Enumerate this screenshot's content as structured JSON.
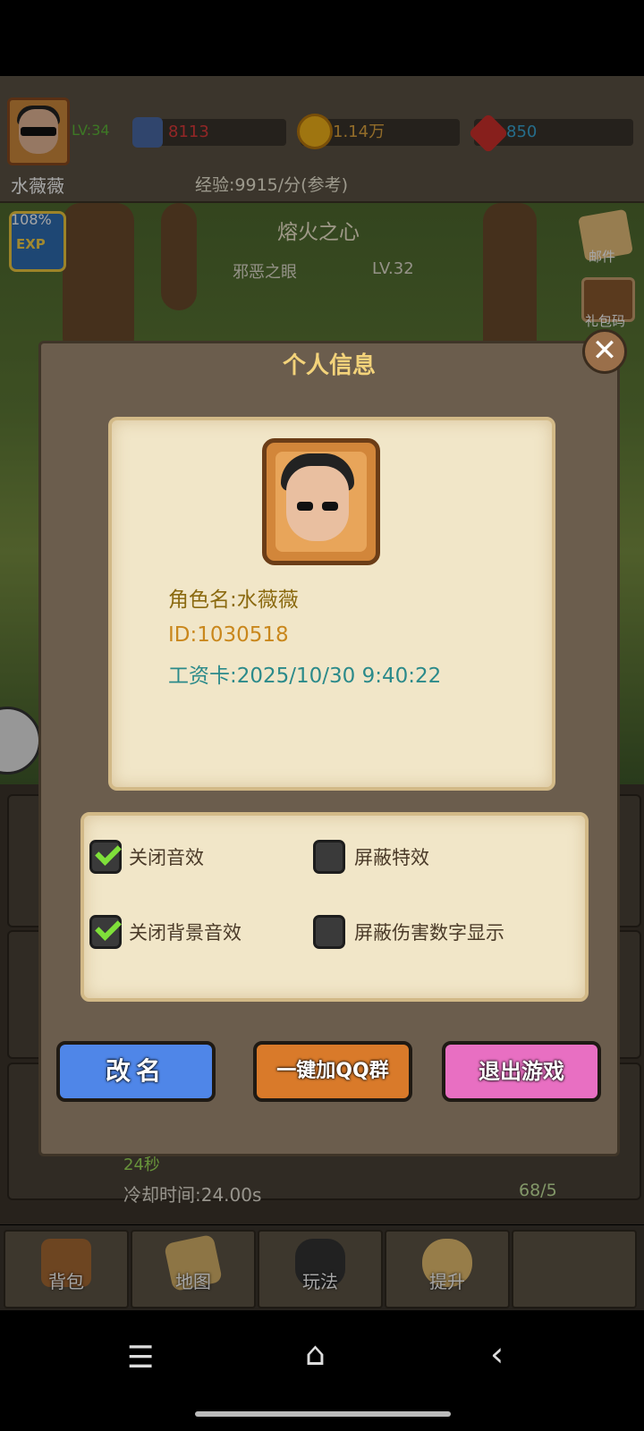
{
  "header": {
    "level": "LV:34",
    "player_name": "水薇薇",
    "exp_rate": "经验:9915/分(参考)",
    "attack": "8113",
    "gold": "1.14万",
    "gems": "850"
  },
  "scene": {
    "exp_badge_pct": "108%",
    "exp_badge_label": "EXP",
    "zone_title": "熔火之心",
    "zone_sub": "邪恶之眼",
    "zone_level": "LV.32",
    "mail_label": "邮件",
    "chest_label": "礼包码"
  },
  "list": {
    "cooldown_top": "24秒",
    "cooldown": "冷却时间:24.00s",
    "count": "68/5"
  },
  "nav": {
    "items": [
      {
        "label": "背包"
      },
      {
        "label": "地图"
      },
      {
        "label": "玩法"
      },
      {
        "label": "提升"
      }
    ]
  },
  "dialog": {
    "title": "个人信息",
    "close": "✕",
    "role_name": "角色名:水薇薇",
    "role_id": "ID:1030518",
    "salary_card": "工资卡:2025/10/30 9:40:22",
    "settings": [
      {
        "label": "关闭音效",
        "checked": true
      },
      {
        "label": "屏蔽特效",
        "checked": false
      },
      {
        "label": "关闭背景音效",
        "checked": true
      },
      {
        "label": "屏蔽伤害数字显示",
        "checked": false
      }
    ],
    "buttons": {
      "rename": "改名",
      "join_qq": "一键加QQ群",
      "exit": "退出游戏"
    }
  },
  "system_nav": {
    "menu": "☰",
    "home": "⌂",
    "back": "‹"
  }
}
